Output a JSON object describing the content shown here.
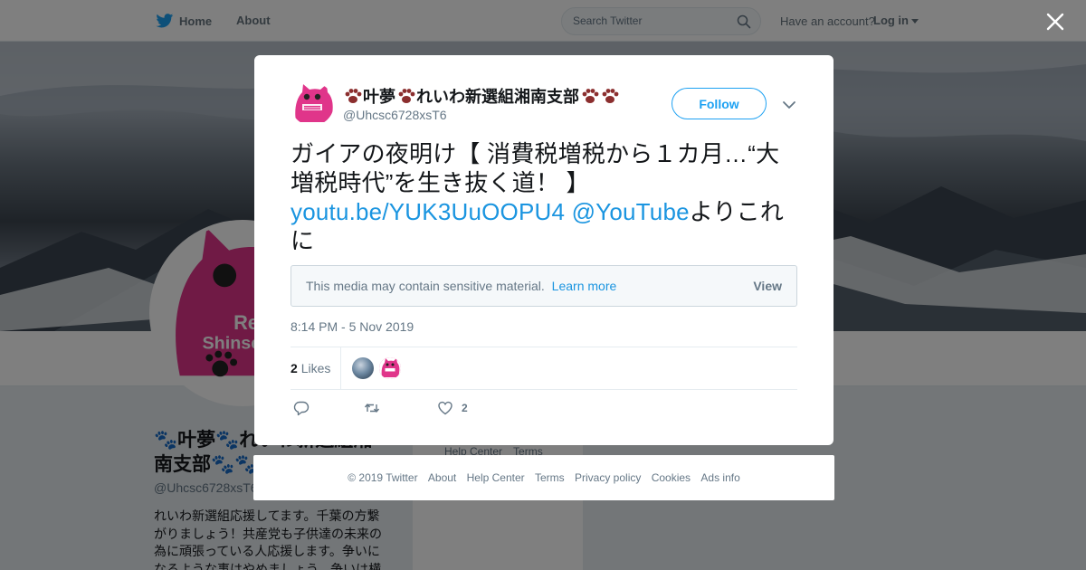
{
  "topbar": {
    "home_label": "Home",
    "about_label": "About",
    "search_placeholder": "Search Twitter",
    "have_account": "Have an account?",
    "login_label": "Log in"
  },
  "profile": {
    "name": "🐾叶夢🐾れいわ新選組湘南支部🐾🐾",
    "handle": "@Uhcsc6728xsT6",
    "bio": "れいわ新選組応援してます。千葉の方繋がりましょう！共産党も子供達の未来の為に頑張っている人応援します。争いになるような事はやめましょう。争いは横",
    "sidebar_links": [
      "Help Center",
      "Terms"
    ]
  },
  "tweet": {
    "author_name": "叶夢",
    "author_name_suffix": "れいわ新選組湘南支部",
    "author_handle": "@Uhcsc6728xsT6",
    "follow_label": "Follow",
    "text_before": "ガイアの夜明け【 消費税増税から１カ月…“大増税時代”を生き抜く道！ 】",
    "link_url": "youtu.be/YUK3UuOOPU4",
    "link_mention": "@YouTube",
    "text_after": "よりこれに",
    "sensitive_message": "This media may contain sensitive material.",
    "learn_more": "Learn more",
    "view_label": "View",
    "timestamp": "8:14 PM - 5 Nov 2019",
    "likes_count": "2",
    "likes_label": "Likes",
    "like_action_count": "2"
  },
  "footer": {
    "links": [
      "© 2019 Twitter",
      "About",
      "Help Center",
      "Terms",
      "Privacy policy",
      "Cookies",
      "Ads info"
    ]
  },
  "colors": {
    "accent": "#1da1f2",
    "link": "#1b95e0",
    "avatar_pink": "#e0358a",
    "paw_brown": "#8b2e2e"
  },
  "icons": [
    "twitter-bird-icon",
    "search-icon",
    "caret-down-icon",
    "close-icon",
    "chevron-down-icon",
    "reply-icon",
    "retweet-icon",
    "heart-icon",
    "paw-icon"
  ]
}
